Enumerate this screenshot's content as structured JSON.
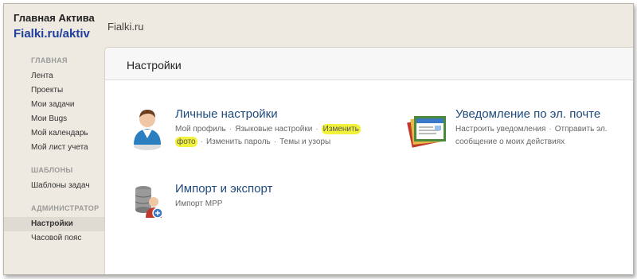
{
  "brand": {
    "title": "Главная Актива",
    "subtitle": "Fialki.ru/aktiv"
  },
  "site_name": "Fialki.ru",
  "sidebar": {
    "main_section": "ГЛАВНАЯ",
    "main_items": [
      "Лента",
      "Проекты",
      "Мои задачи",
      "Мои Bugs",
      "Мой календарь",
      "Мой лист учета"
    ],
    "templates_section": "ШАБЛОНЫ",
    "templates_items": [
      "Шаблоны задач"
    ],
    "admin_section": "АДМИНИСТРАТОР",
    "admin_items": [
      "Настройки",
      "Часовой пояс"
    ]
  },
  "main": {
    "title": "Настройки",
    "personal": {
      "title": "Личные настройки",
      "links": [
        "Мой профиль",
        "Языковые настройки",
        "Изменить",
        "фото",
        "Изменить пароль",
        "Темы и узоры"
      ]
    },
    "email": {
      "title": "Уведомление по эл. почте",
      "links": [
        "Настроить уведомления",
        "Отправить эл.",
        "сообщение о моих действиях"
      ]
    },
    "import": {
      "title": "Импорт и экспорт",
      "links": [
        "Импорт MPP"
      ]
    }
  },
  "colors": {
    "highlight": "#f2f23a",
    "link_title": "#1f4a7a",
    "brand_blue": "#1f3f9f"
  }
}
